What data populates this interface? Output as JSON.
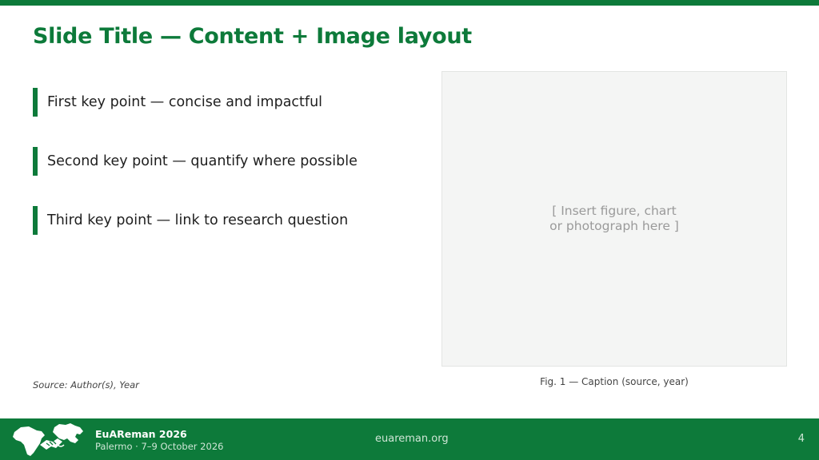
{
  "slide": {
    "title": "Slide Title — Content + Image layout",
    "bullets": [
      "First key point — concise and impactful",
      "Second key point — quantify where possible",
      "Third key point — link to research question"
    ],
    "source": "Source: Author(s), Year",
    "image_placeholder": {
      "line1": "[ Insert figure, chart",
      "line2": "or photograph here ]"
    },
    "caption": "Fig. 1 — Caption (source, year)"
  },
  "footer": {
    "brand": "EuAReman 2026",
    "event": "Palermo · 7–9 October 2026",
    "website": "euareman.org",
    "page_number": "4"
  },
  "colors": {
    "accent": "#0d7a3a",
    "placeholder_bg": "#f4f5f4"
  },
  "icons": {
    "logo": "africa-europe-handshake-logo"
  }
}
